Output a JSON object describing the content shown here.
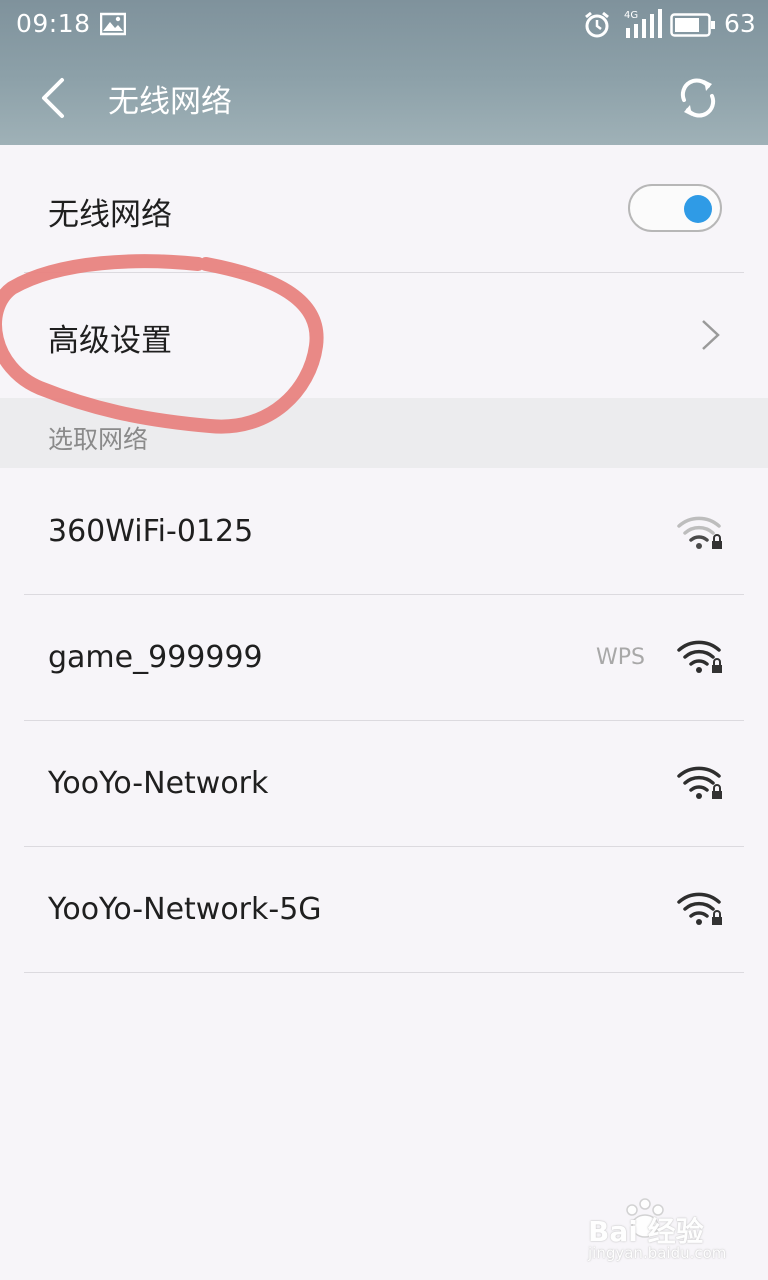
{
  "status_bar": {
    "time": "09:18",
    "network_type": "4G",
    "battery_percent": "63",
    "icons": [
      "image-icon",
      "alarm-icon",
      "signal-icon",
      "battery-icon"
    ]
  },
  "app_bar": {
    "title": "无线网络",
    "back_icon": "chevron-left-icon",
    "refresh_icon": "refresh-icon"
  },
  "wifi_toggle": {
    "label": "无线网络",
    "enabled": true,
    "accent": "#2f9be6"
  },
  "advanced": {
    "label": "高级设置"
  },
  "section_header": {
    "label": "选取网络"
  },
  "networks": [
    {
      "ssid": "360WiFi-0125",
      "badge": "",
      "strength": "weak",
      "secured": true
    },
    {
      "ssid": "game_999999",
      "badge": "WPS",
      "strength": "strong",
      "secured": true
    },
    {
      "ssid": "YooYo-Network",
      "badge": "",
      "strength": "strong",
      "secured": true
    },
    {
      "ssid": "YooYo-Network-5G",
      "badge": "",
      "strength": "strong",
      "secured": true
    }
  ],
  "watermark": {
    "brand": "Bai 经验",
    "site": "jingyan.baidu.com"
  },
  "colors": {
    "header": "#8a9ea7",
    "background": "#f7f5f9",
    "annotation": "#e8837f"
  }
}
